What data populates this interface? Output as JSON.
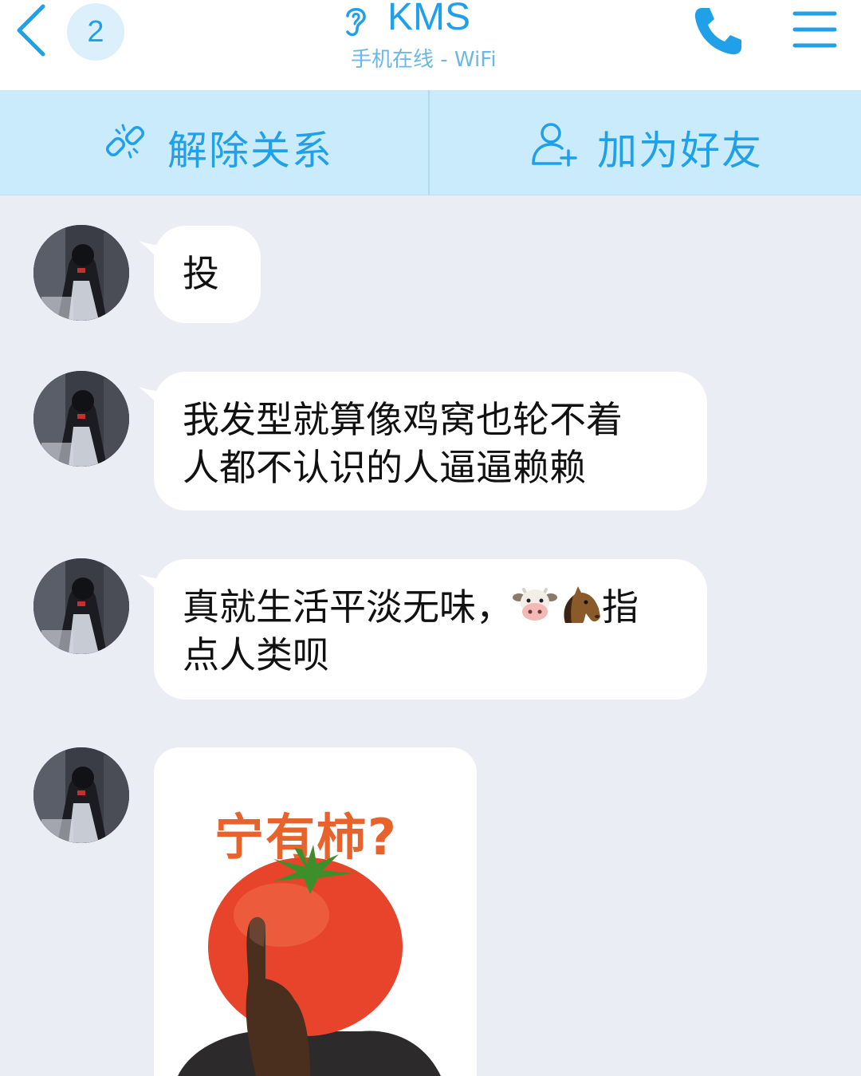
{
  "header": {
    "unread_count": "2",
    "title": "KMS",
    "status": "手机在线 - WiFi"
  },
  "actions": {
    "unlink_label": "解除关系",
    "add_friend_label": "加为好友"
  },
  "messages": [
    {
      "text": "投"
    },
    {
      "line1": "我发型就算像鸡窝也轮不着",
      "line2": "人都不认识的人逼逼赖赖"
    },
    {
      "line1_before": "真就生活平淡无味，",
      "emojis": [
        "cow-face-icon",
        "horse-face-icon"
      ],
      "line1_after": "指",
      "line2": "点人类呗"
    },
    {
      "sticker_text": "宁有柿?"
    }
  ],
  "colors": {
    "accent": "#1fa0e8",
    "action_bar_bg": "#c9ebfb",
    "chat_bg": "#ebedf5",
    "bubble_bg": "#ffffff",
    "sticker_text": "#e8632b",
    "tomato": "#e8442c"
  }
}
